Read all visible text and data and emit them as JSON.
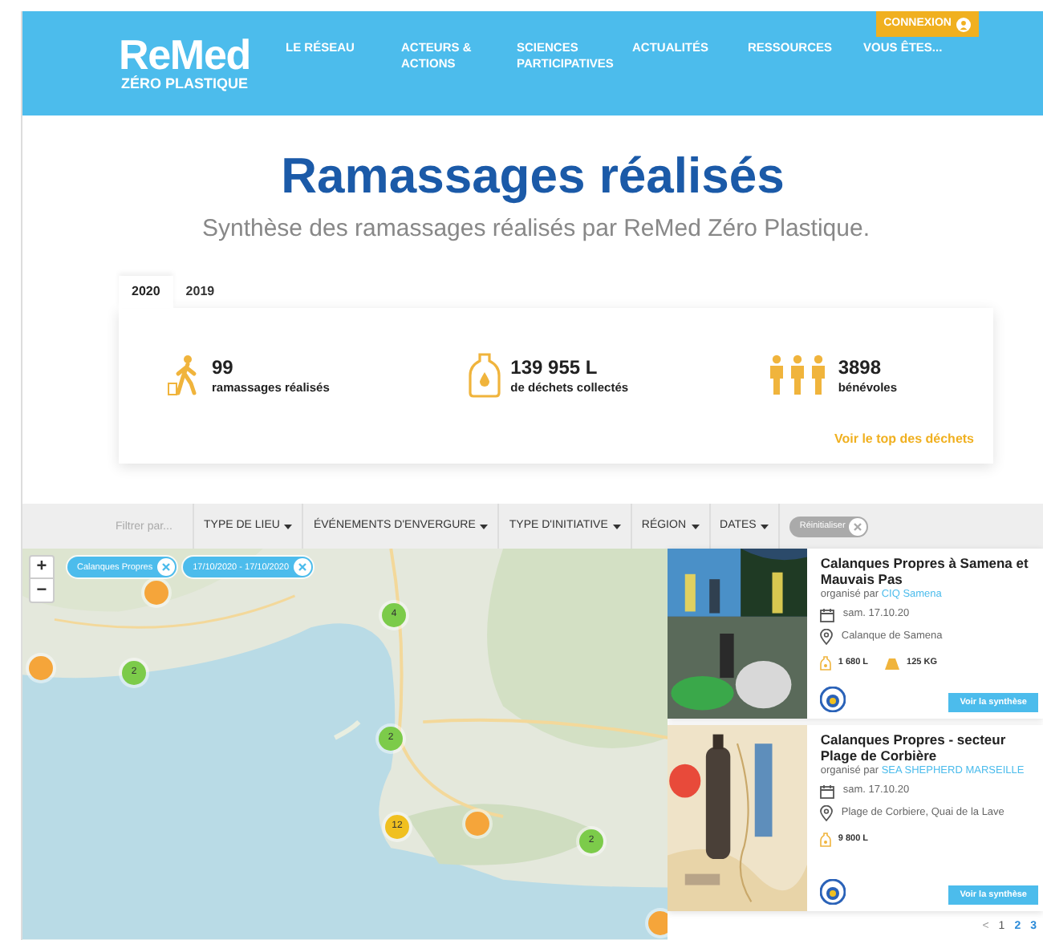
{
  "header": {
    "logo": {
      "title": "ReMed",
      "subtitle": "ZÉRO PLASTIQUE"
    },
    "nav": [
      "LE RÉSEAU",
      "ACTEURS & ACTIONS",
      "SCIENCES PARTICIPATIVES",
      "ACTUALITÉS",
      "RESSOURCES",
      "VOUS ÊTES..."
    ],
    "login": "CONNEXION"
  },
  "title": "Ramassages réalisés",
  "subtitle": "Synthèse des ramassages réalisés par ReMed Zéro Plastique.",
  "year_tabs": [
    {
      "label": "2020",
      "selected": true
    },
    {
      "label": "2019",
      "selected": false
    }
  ],
  "stats": [
    {
      "kind": "walker",
      "value": "99",
      "label": "ramassages réalisés"
    },
    {
      "kind": "bottle",
      "value": "139 955 L",
      "label": "de déchets collectés"
    },
    {
      "kind": "people",
      "value": "3898",
      "label": "bénévoles"
    }
  ],
  "top_link": "Voir le top des déchets",
  "filters": {
    "placeholder": "Filtrer par...",
    "dropdowns": [
      "TYPE DE LIEU",
      "ÉVÉNEMENTS D'ENVERGURE",
      "TYPE D'INITIATIVE",
      "RÉGION",
      "DATES"
    ],
    "reset": "Réinitialiser"
  },
  "map": {
    "zoom_in": "+",
    "zoom_out": "−",
    "chips": [
      "Calanques Propres",
      "17/10/2020 - 17/10/2020"
    ],
    "markers": [
      {
        "count": "4",
        "color": "#7ccb4a"
      },
      {
        "count": "2",
        "color": "#7ccb4a"
      },
      {
        "count": "2",
        "color": "#7ccb4a"
      },
      {
        "count": "12",
        "color": "#f0c020"
      },
      {
        "count": "2",
        "color": "#7ccb4a"
      },
      {
        "color": "#f5a53a"
      },
      {
        "color": "#f5a53a"
      },
      {
        "color": "#f5a53a"
      },
      {
        "color": "#f5a53a"
      }
    ]
  },
  "results": [
    {
      "title": "Calanques Propres à Samena et Mauvais Pas",
      "by": "organisé par",
      "organizer": "CIQ Samena",
      "date": "sam. 17.10.20",
      "place": "Calanque de Samena",
      "volume": "1 680 L",
      "weight": "125 KG",
      "button": "Voir la synthèse"
    },
    {
      "title": "Calanques Propres - secteur Plage de Corbière",
      "by": "organisé par",
      "organizer": "SEA SHEPHERD MARSEILLE",
      "date": "sam. 17.10.20",
      "place": "Plage de Corbiere, Quai de la Lave",
      "volume": "9 800 L",
      "button": "Voir la synthèse"
    }
  ],
  "pagination": {
    "prev": "<",
    "pages": [
      {
        "label": "1",
        "selected": true
      },
      {
        "label": "2",
        "selected": false
      },
      {
        "label": "3",
        "selected": false
      }
    ]
  }
}
